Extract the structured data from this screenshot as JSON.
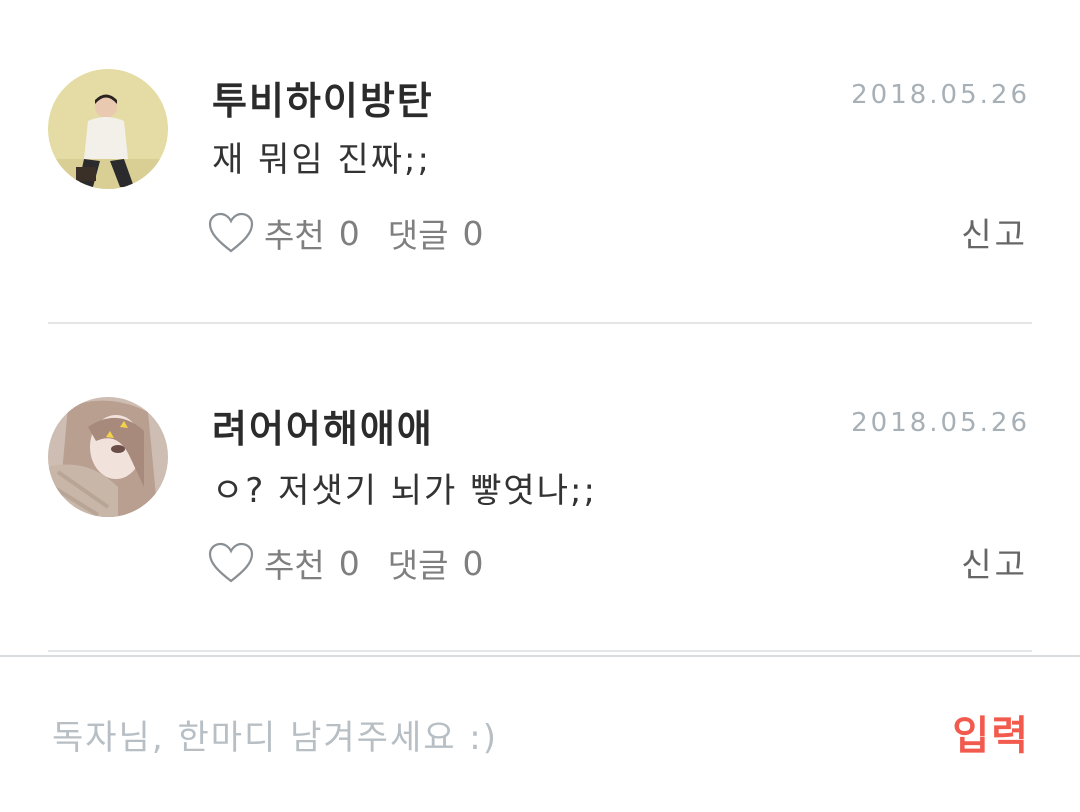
{
  "comments": [
    {
      "author": "투비하이방탄",
      "date": "2018.05.26",
      "text": "재 뭐임 진짜;;",
      "like_label": "추천",
      "like_count": "0",
      "reply_label": "댓글",
      "reply_count": "0",
      "report_label": "신고"
    },
    {
      "author": "려어어해애애",
      "date": "2018.05.26",
      "text": "ㅇ? 저샛기 뇌가 빻엿나;;",
      "like_label": "추천",
      "like_count": "0",
      "reply_label": "댓글",
      "reply_count": "0",
      "report_label": "신고"
    }
  ],
  "input": {
    "placeholder": "독자님, 한마디 남겨주세요 :)",
    "submit_label": "입력"
  },
  "colors": {
    "accent": "#f25a4e",
    "date": "#a7b0b6",
    "divider": "#e4e6e8"
  }
}
